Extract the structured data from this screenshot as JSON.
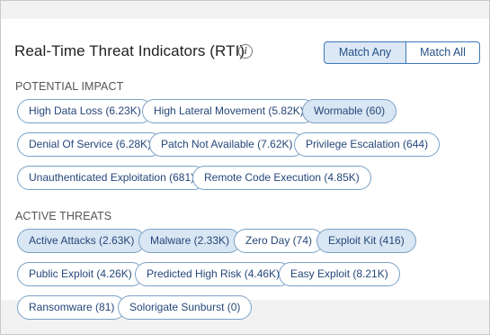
{
  "header": {
    "title": "Real-Time Threat Indicators (RTI)",
    "info_icon_glyph": "i"
  },
  "match_toggle": {
    "any_label": "Match Any",
    "all_label": "Match All",
    "selected": "Match Any"
  },
  "potential_impact": {
    "label": "POTENTIAL IMPACT",
    "chips": [
      {
        "label": "High Data Loss (6.23K)",
        "selected": false
      },
      {
        "label": "High Lateral Movement (5.82K)",
        "selected": false
      },
      {
        "label": "Wormable (60)",
        "selected": true
      },
      {
        "label": "Denial Of Service (6.28K)",
        "selected": false
      },
      {
        "label": "Patch Not Available (7.62K)",
        "selected": false
      },
      {
        "label": "Privilege Escalation (644)",
        "selected": false
      },
      {
        "label": "Unauthenticated Exploitation (681)",
        "selected": false
      },
      {
        "label": "Remote Code Execution (4.85K)",
        "selected": false
      }
    ]
  },
  "active_threats": {
    "label": "ACTIVE THREATS",
    "chips": [
      {
        "label": "Active Attacks (2.63K)",
        "selected": true
      },
      {
        "label": "Malware (2.33K)",
        "selected": true
      },
      {
        "label": "Zero Day (74)",
        "selected": false
      },
      {
        "label": "Exploit Kit (416)",
        "selected": true
      },
      {
        "label": "Public Exploit (4.26K)",
        "selected": false
      },
      {
        "label": "Predicted High Risk (4.46K)",
        "selected": false
      },
      {
        "label": "Easy Exploit (8.21K)",
        "selected": false
      },
      {
        "label": "Ransomware (81)",
        "selected": false
      },
      {
        "label": "Solorigate Sunburst (0)",
        "selected": false
      }
    ]
  },
  "colors": {
    "chip_border": "#7aa1c6",
    "chip_selected_bg": "#d9e6f3",
    "chip_text": "#25477a",
    "toggle_border": "#3c79b8"
  }
}
